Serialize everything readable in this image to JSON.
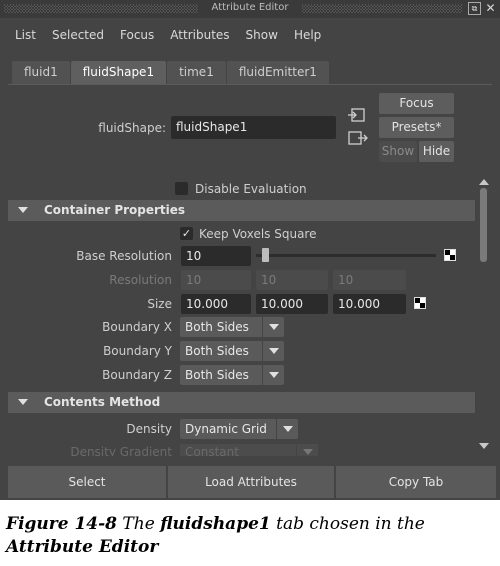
{
  "window": {
    "title": "Attribute Editor",
    "float_glyph": "⧉",
    "close_glyph": "✕"
  },
  "menu": [
    "List",
    "Selected",
    "Focus",
    "Attributes",
    "Show",
    "Help"
  ],
  "tabs": [
    {
      "label": "fluid1",
      "active": false
    },
    {
      "label": "fluidShape1",
      "active": true
    },
    {
      "label": "time1",
      "active": false
    },
    {
      "label": "fluidEmitter1",
      "active": false
    }
  ],
  "node": {
    "label": "fluidShape:",
    "value": "fluidShape1"
  },
  "buttons": {
    "focus": "Focus",
    "presets": "Presets*",
    "show": "Show",
    "hide": "Hide"
  },
  "disable_evaluation": {
    "label": "Disable Evaluation",
    "checked": false
  },
  "container_properties": {
    "title": "Container Properties",
    "keep_voxels_square": {
      "label": "Keep Voxels Square",
      "checked": true,
      "mark": "✓"
    },
    "base_resolution": {
      "label": "Base Resolution",
      "value": "10"
    },
    "resolution": {
      "label": "Resolution",
      "values": [
        "10",
        "10",
        "10"
      ]
    },
    "size": {
      "label": "Size",
      "values": [
        "10.000",
        "10.000",
        "10.000"
      ]
    },
    "boundary_x": {
      "label": "Boundary X",
      "value": "Both Sides"
    },
    "boundary_y": {
      "label": "Boundary Y",
      "value": "Both Sides"
    },
    "boundary_z": {
      "label": "Boundary Z",
      "value": "Both Sides"
    }
  },
  "contents_method": {
    "title": "Contents Method",
    "density": {
      "label": "Density",
      "value": "Dynamic Grid"
    },
    "density_gradient": {
      "label": "Density Gradient",
      "value": "Constant"
    }
  },
  "bottom_buttons": {
    "select": "Select",
    "load_attributes": "Load Attributes",
    "copy_tab": "Copy Tab"
  },
  "caption": {
    "figure": "Figure 14-8",
    "text_1": "The",
    "bold_1": "fluidshape1",
    "text_2": "tab chosen in the",
    "bold_2": "Attribute Editor"
  },
  "colors": {
    "panel": "#444444",
    "field": "#2b2b2b",
    "section": "#5b5b5b",
    "button": "#5a5a5a"
  }
}
